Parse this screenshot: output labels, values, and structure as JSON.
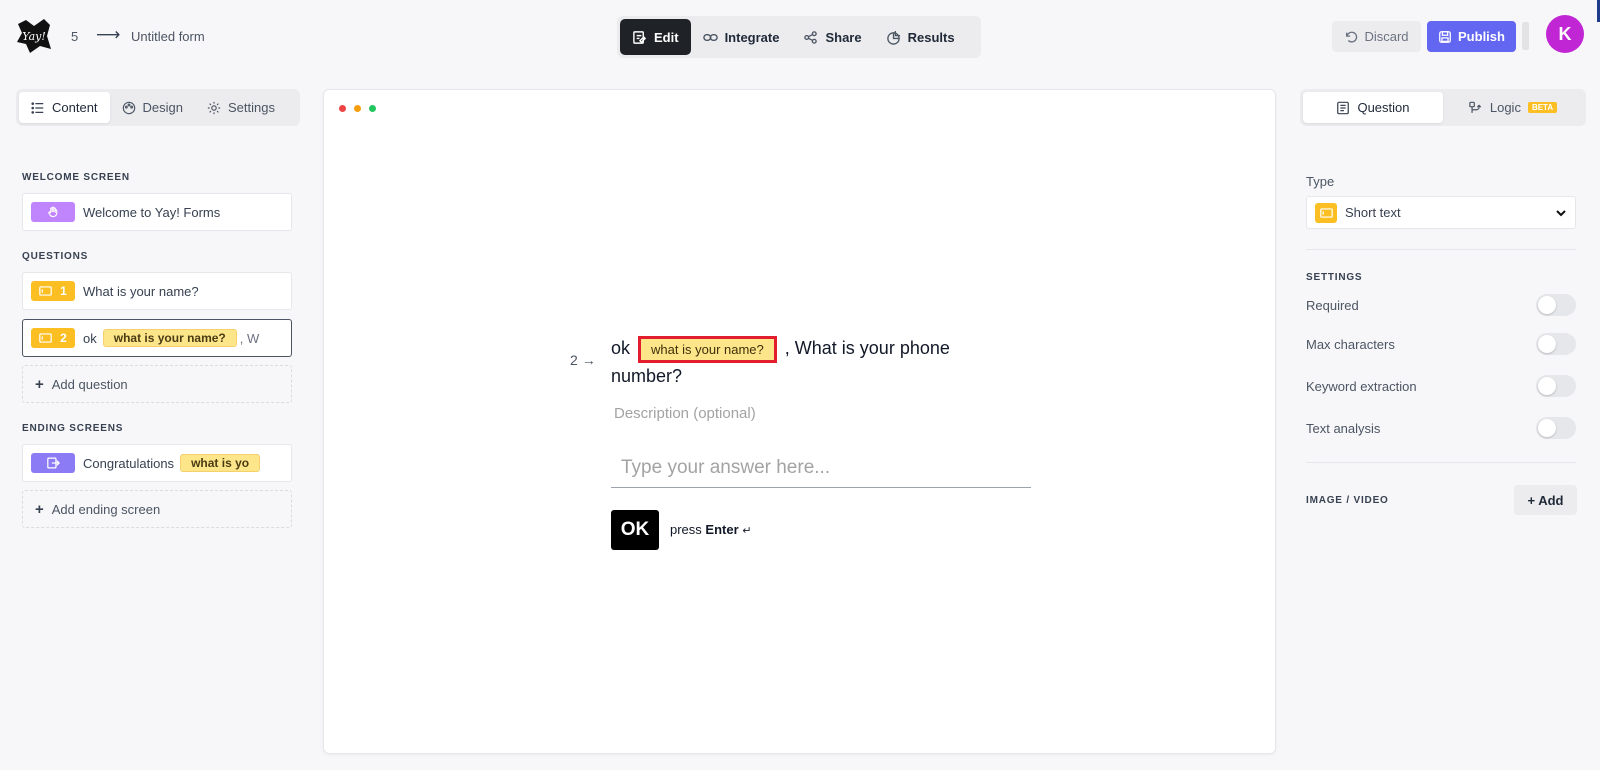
{
  "header": {
    "logo_text": "Yay!",
    "question_count": "5",
    "arrow": "⟶",
    "form_title": "Untitled form",
    "modes": [
      {
        "label": "Edit",
        "icon": "edit-icon",
        "active": true
      },
      {
        "label": "Integrate",
        "icon": "link-icon",
        "active": false
      },
      {
        "label": "Share",
        "icon": "share-icon",
        "active": false
      },
      {
        "label": "Results",
        "icon": "pie-chart-icon",
        "active": false
      }
    ],
    "discard_label": "Discard",
    "publish_label": "Publish",
    "avatar_initial": "K",
    "accent_color": "#6366f1",
    "avatar_color": "#c026d3"
  },
  "sidebar": {
    "tabs": [
      {
        "label": "Content",
        "icon": "list-icon",
        "active": true
      },
      {
        "label": "Design",
        "icon": "palette-icon",
        "active": false
      },
      {
        "label": "Settings",
        "icon": "gear-icon",
        "active": false
      }
    ],
    "welcome_section": "WELCOME SCREEN",
    "welcome_item": "Welcome to Yay! Forms",
    "questions_section": "QUESTIONS",
    "questions": [
      {
        "number": "1",
        "prefix": "What is your name?",
        "pill": "",
        "suffix": ""
      },
      {
        "number": "2",
        "prefix": "ok",
        "pill": "what is your name?",
        "suffix": ", W"
      }
    ],
    "add_question": "Add question",
    "ending_section": "ENDING SCREENS",
    "ending_item": {
      "prefix": "Congratulations",
      "pill": "what is yo"
    },
    "add_ending": "Add ending screen"
  },
  "preview": {
    "question_number": "2",
    "arrow": "→",
    "text_prefix": "ok",
    "pill": "what is your name?",
    "text_suffix": ", What is your phone number?",
    "description_placeholder": "Description (optional)",
    "answer_placeholder": "Type your answer here...",
    "ok_label": "OK",
    "press_label": "press",
    "enter_label": "Enter",
    "enter_symbol": "↵"
  },
  "right_panel": {
    "tabs": [
      {
        "label": "Question",
        "icon": "question-doc-icon",
        "active": true
      },
      {
        "label": "Logic",
        "icon": "logic-icon",
        "active": false,
        "badge": "BETA"
      }
    ],
    "type_label": "Type",
    "type_value": "Short text",
    "settings_label": "SETTINGS",
    "settings": [
      {
        "label": "Required",
        "on": false
      },
      {
        "label": "Max characters",
        "on": false
      },
      {
        "label": "Keyword extraction",
        "on": false
      },
      {
        "label": "Text analysis",
        "on": false
      }
    ],
    "media_label": "IMAGE / VIDEO",
    "media_add": "+ Add"
  }
}
